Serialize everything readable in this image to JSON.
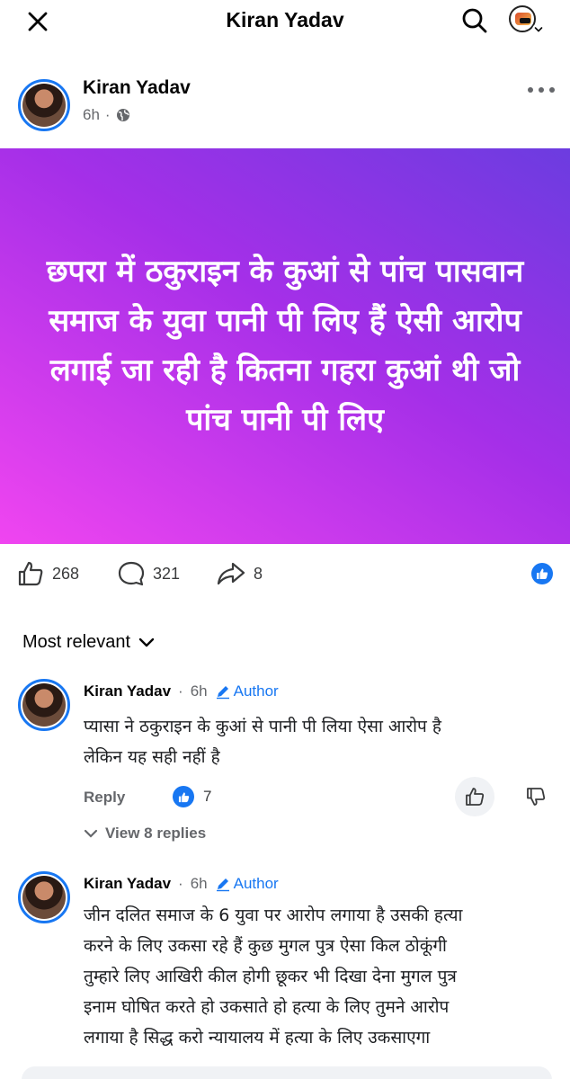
{
  "topbar": {
    "title": "Kiran Yadav",
    "close_icon": "close-icon",
    "search_icon": "search-icon"
  },
  "post": {
    "author": "Kiran Yadav",
    "time": "6h",
    "visibility_icon": "globe-icon",
    "text": "छपरा में ठकुराइन  के कुआं से पांच पासवान समाज के  युवा पानी पी लिए हैं ऐसी आरोप लगाई जा रही है कितना गहरा कुआं थी जो पांच पानी पी लिए",
    "gradient_colors": [
      "#6c3ce0",
      "#a52fe8",
      "#f045f0"
    ]
  },
  "reactions": {
    "likes": "268",
    "comments": "321",
    "shares": "8"
  },
  "comments_section": {
    "sort_label": "Most relevant"
  },
  "comments": [
    {
      "name": "Kiran Yadav",
      "time": "6h",
      "badge": "Author",
      "text_lines": [
        "प्यासा ने ठकुराइन के कुआं से पानी पी लिया ऐसा आरोप है",
        "लेकिन यह सही नहीं है"
      ],
      "reply_label": "Reply",
      "like_count": "7",
      "view_replies": "View 8 replies"
    },
    {
      "name": "Kiran Yadav",
      "time": "6h",
      "badge": "Author",
      "text_lines": [
        "जीन दलित समाज के 6 युवा पर आरोप लगाया है उसकी हत्या",
        "करने के लिए उकसा रहे हैं कुछ मुगल पुत्र ऐसा किल ठोकूंगी",
        "तुम्हारे लिए आखिरी कील होगी छूकर भी दिखा देना मुगल पुत्र",
        "इनाम घोषित करते हो उकसाते  हो हत्या के लिए तुमने आरोप",
        "लगाया है सिद्ध करो न्यायालय में हत्या के लिए उकसाएगा"
      ]
    }
  ],
  "colors": {
    "accent": "#1877f2",
    "secondary_text": "#65676b"
  }
}
